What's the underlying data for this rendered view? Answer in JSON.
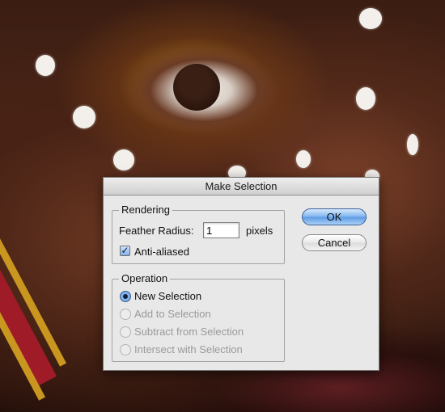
{
  "dialog": {
    "title": "Make Selection",
    "rendering": {
      "legend": "Rendering",
      "feather_label": "Feather Radius:",
      "feather_value": "1",
      "unit": "pixels",
      "anti_aliased_label": "Anti-aliased",
      "anti_aliased_checked": true
    },
    "operation": {
      "legend": "Operation",
      "options": [
        {
          "label": "New Selection",
          "selected": true,
          "enabled": true
        },
        {
          "label": "Add to Selection",
          "selected": false,
          "enabled": false
        },
        {
          "label": "Subtract from Selection",
          "selected": false,
          "enabled": false
        },
        {
          "label": "Intersect with Selection",
          "selected": false,
          "enabled": false
        }
      ]
    },
    "buttons": {
      "ok": "OK",
      "cancel": "Cancel"
    }
  },
  "colors": {
    "default_button": "#7eb4ee",
    "dialog_bg": "#e8e8e8",
    "disabled_text": "#9a9a9a"
  }
}
